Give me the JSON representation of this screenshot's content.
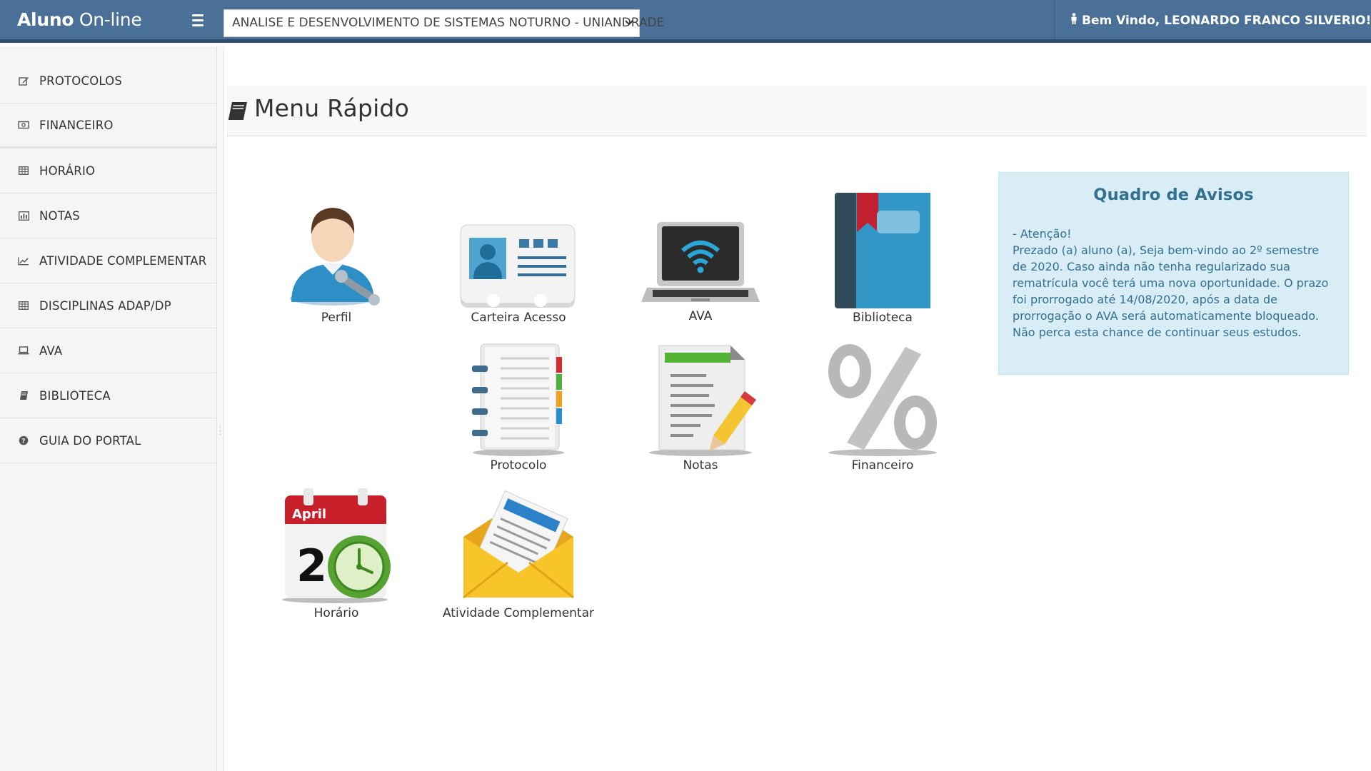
{
  "header": {
    "brand_bold": "Aluno",
    "brand_rest": " On-line",
    "course_select": "ANALISE E DESENVOLVIMENTO DE SISTEMAS NOTURNO - UNIANDRADE",
    "user_greeting": "Bem Vindo, LEONARDO FRANCO SILVERIO!"
  },
  "sidebar": {
    "items": [
      {
        "label": "PROTOCOLOS",
        "icon": "edit-icon"
      },
      {
        "label": "FINANCEIRO",
        "icon": "money-icon"
      },
      {
        "label": "HORÁRIO",
        "icon": "table-icon"
      },
      {
        "label": "NOTAS",
        "icon": "bar-chart-icon"
      },
      {
        "label": "ATIVIDADE COMPLEMENTAR",
        "icon": "line-chart-icon"
      },
      {
        "label": "DISCIPLINAS ADAP/DP",
        "icon": "table-icon"
      },
      {
        "label": "AVA",
        "icon": "laptop-icon"
      },
      {
        "label": "BIBLIOTECA",
        "icon": "book-icon"
      },
      {
        "label": "GUIA DO PORTAL",
        "icon": "question-circle-icon"
      }
    ]
  },
  "main": {
    "title": "Menu Rápido",
    "tiles": [
      {
        "label": "Perfil",
        "icon": "user-profile-icon"
      },
      {
        "label": "Carteira Acesso",
        "icon": "id-card-icon"
      },
      {
        "label": "AVA",
        "icon": "laptop-wifi-icon"
      },
      {
        "label": "Biblioteca",
        "icon": "library-book-icon"
      },
      {
        "label": "Protocolo",
        "icon": "notebook-icon"
      },
      {
        "label": "Notas",
        "icon": "document-pencil-icon"
      },
      {
        "label": "Financeiro",
        "icon": "percent-icon"
      },
      {
        "label": "Horário",
        "icon": "calendar-clock-icon",
        "calendar_month": "April",
        "calendar_day": "2"
      },
      {
        "label": "Atividade Complementar",
        "icon": "envelope-letter-icon"
      }
    ]
  },
  "notices": {
    "title": "Quadro de Avisos",
    "body": "- Atenção!\nPrezado (a) aluno (a), Seja bem-vindo ao 2º semestre de 2020. Caso ainda não tenha regularizado sua rematrícula você terá uma nova oportunidade. O prazo foi prorrogado até 14/08/2020, após a data de prorrogação o AVA será automaticamente bloqueado. Não perca esta chance de continuar seus estudos."
  },
  "colors": {
    "topbar": "#4b7098",
    "topbar_border": "#2f4d6a",
    "notice_bg": "#d9edf7",
    "notice_text": "#31708f"
  }
}
